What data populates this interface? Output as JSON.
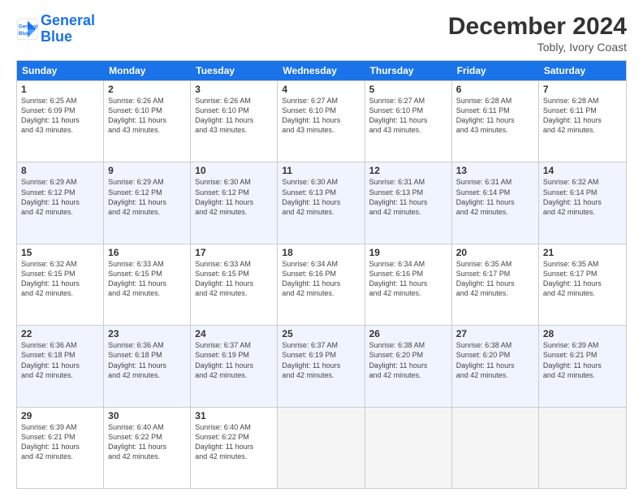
{
  "logo": {
    "line1": "General",
    "line2": "Blue"
  },
  "header": {
    "title": "December 2024",
    "subtitle": "Tobly, Ivory Coast"
  },
  "days_of_week": [
    "Sunday",
    "Monday",
    "Tuesday",
    "Wednesday",
    "Thursday",
    "Friday",
    "Saturday"
  ],
  "rows": [
    [
      {
        "day": "1",
        "info": "Sunrise: 6:25 AM\nSunset: 6:09 PM\nDaylight: 11 hours\nand 43 minutes.",
        "shaded": false
      },
      {
        "day": "2",
        "info": "Sunrise: 6:26 AM\nSunset: 6:10 PM\nDaylight: 11 hours\nand 43 minutes.",
        "shaded": false
      },
      {
        "day": "3",
        "info": "Sunrise: 6:26 AM\nSunset: 6:10 PM\nDaylight: 11 hours\nand 43 minutes.",
        "shaded": false
      },
      {
        "day": "4",
        "info": "Sunrise: 6:27 AM\nSunset: 6:10 PM\nDaylight: 11 hours\nand 43 minutes.",
        "shaded": false
      },
      {
        "day": "5",
        "info": "Sunrise: 6:27 AM\nSunset: 6:10 PM\nDaylight: 11 hours\nand 43 minutes.",
        "shaded": false
      },
      {
        "day": "6",
        "info": "Sunrise: 6:28 AM\nSunset: 6:11 PM\nDaylight: 11 hours\nand 43 minutes.",
        "shaded": false
      },
      {
        "day": "7",
        "info": "Sunrise: 6:28 AM\nSunset: 6:11 PM\nDaylight: 11 hours\nand 42 minutes.",
        "shaded": false
      }
    ],
    [
      {
        "day": "8",
        "info": "Sunrise: 6:29 AM\nSunset: 6:12 PM\nDaylight: 11 hours\nand 42 minutes.",
        "shaded": true
      },
      {
        "day": "9",
        "info": "Sunrise: 6:29 AM\nSunset: 6:12 PM\nDaylight: 11 hours\nand 42 minutes.",
        "shaded": true
      },
      {
        "day": "10",
        "info": "Sunrise: 6:30 AM\nSunset: 6:12 PM\nDaylight: 11 hours\nand 42 minutes.",
        "shaded": true
      },
      {
        "day": "11",
        "info": "Sunrise: 6:30 AM\nSunset: 6:13 PM\nDaylight: 11 hours\nand 42 minutes.",
        "shaded": true
      },
      {
        "day": "12",
        "info": "Sunrise: 6:31 AM\nSunset: 6:13 PM\nDaylight: 11 hours\nand 42 minutes.",
        "shaded": true
      },
      {
        "day": "13",
        "info": "Sunrise: 6:31 AM\nSunset: 6:14 PM\nDaylight: 11 hours\nand 42 minutes.",
        "shaded": true
      },
      {
        "day": "14",
        "info": "Sunrise: 6:32 AM\nSunset: 6:14 PM\nDaylight: 11 hours\nand 42 minutes.",
        "shaded": true
      }
    ],
    [
      {
        "day": "15",
        "info": "Sunrise: 6:32 AM\nSunset: 6:15 PM\nDaylight: 11 hours\nand 42 minutes.",
        "shaded": false
      },
      {
        "day": "16",
        "info": "Sunrise: 6:33 AM\nSunset: 6:15 PM\nDaylight: 11 hours\nand 42 minutes.",
        "shaded": false
      },
      {
        "day": "17",
        "info": "Sunrise: 6:33 AM\nSunset: 6:15 PM\nDaylight: 11 hours\nand 42 minutes.",
        "shaded": false
      },
      {
        "day": "18",
        "info": "Sunrise: 6:34 AM\nSunset: 6:16 PM\nDaylight: 11 hours\nand 42 minutes.",
        "shaded": false
      },
      {
        "day": "19",
        "info": "Sunrise: 6:34 AM\nSunset: 6:16 PM\nDaylight: 11 hours\nand 42 minutes.",
        "shaded": false
      },
      {
        "day": "20",
        "info": "Sunrise: 6:35 AM\nSunset: 6:17 PM\nDaylight: 11 hours\nand 42 minutes.",
        "shaded": false
      },
      {
        "day": "21",
        "info": "Sunrise: 6:35 AM\nSunset: 6:17 PM\nDaylight: 11 hours\nand 42 minutes.",
        "shaded": false
      }
    ],
    [
      {
        "day": "22",
        "info": "Sunrise: 6:36 AM\nSunset: 6:18 PM\nDaylight: 11 hours\nand 42 minutes.",
        "shaded": true
      },
      {
        "day": "23",
        "info": "Sunrise: 6:36 AM\nSunset: 6:18 PM\nDaylight: 11 hours\nand 42 minutes.",
        "shaded": true
      },
      {
        "day": "24",
        "info": "Sunrise: 6:37 AM\nSunset: 6:19 PM\nDaylight: 11 hours\nand 42 minutes.",
        "shaded": true
      },
      {
        "day": "25",
        "info": "Sunrise: 6:37 AM\nSunset: 6:19 PM\nDaylight: 11 hours\nand 42 minutes.",
        "shaded": true
      },
      {
        "day": "26",
        "info": "Sunrise: 6:38 AM\nSunset: 6:20 PM\nDaylight: 11 hours\nand 42 minutes.",
        "shaded": true
      },
      {
        "day": "27",
        "info": "Sunrise: 6:38 AM\nSunset: 6:20 PM\nDaylight: 11 hours\nand 42 minutes.",
        "shaded": true
      },
      {
        "day": "28",
        "info": "Sunrise: 6:39 AM\nSunset: 6:21 PM\nDaylight: 11 hours\nand 42 minutes.",
        "shaded": true
      }
    ],
    [
      {
        "day": "29",
        "info": "Sunrise: 6:39 AM\nSunset: 6:21 PM\nDaylight: 11 hours\nand 42 minutes.",
        "shaded": false
      },
      {
        "day": "30",
        "info": "Sunrise: 6:40 AM\nSunset: 6:22 PM\nDaylight: 11 hours\nand 42 minutes.",
        "shaded": false
      },
      {
        "day": "31",
        "info": "Sunrise: 6:40 AM\nSunset: 6:22 PM\nDaylight: 11 hours\nand 42 minutes.",
        "shaded": false
      },
      {
        "day": "",
        "info": "",
        "shaded": false,
        "empty": true
      },
      {
        "day": "",
        "info": "",
        "shaded": false,
        "empty": true
      },
      {
        "day": "",
        "info": "",
        "shaded": false,
        "empty": true
      },
      {
        "day": "",
        "info": "",
        "shaded": false,
        "empty": true
      }
    ]
  ]
}
